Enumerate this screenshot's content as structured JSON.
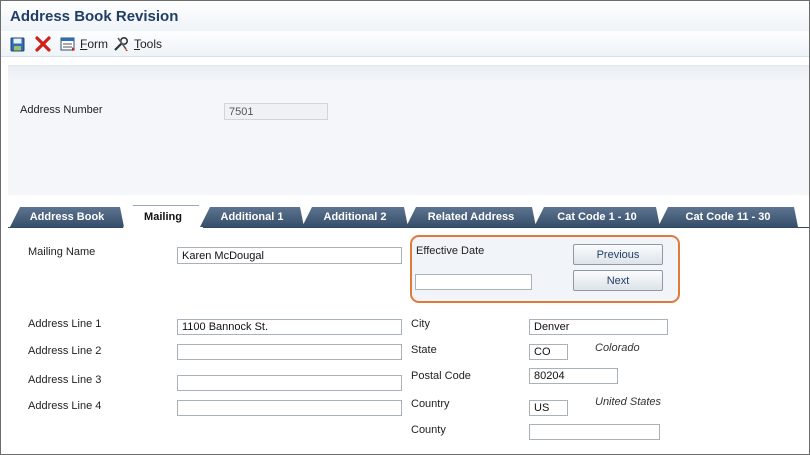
{
  "window": {
    "title": "Address Book Revision"
  },
  "toolbar": {
    "save_icon": "save-icon",
    "cancel_icon": "close-icon",
    "form_label_first": "F",
    "form_label_rest": "orm",
    "tools_label_first": "T",
    "tools_label_rest": "ools"
  },
  "header": {
    "address_number_label": "Address Number",
    "address_number_value": "7501"
  },
  "tabs": [
    {
      "label": "Address Book"
    },
    {
      "label": "Mailing",
      "active": true
    },
    {
      "label": "Additional 1"
    },
    {
      "label": "Additional 2"
    },
    {
      "label": "Related Address"
    },
    {
      "label": "Cat Code 1 - 10"
    },
    {
      "label": "Cat Code 11 - 30"
    }
  ],
  "mailing": {
    "mailing_name_label": "Mailing Name",
    "mailing_name_value": "Karen McDougal",
    "effective_date_label": "Effective Date",
    "effective_date_value": "",
    "previous_label": "Previous",
    "next_label": "Next",
    "address_line_1_label": "Address Line 1",
    "address_line_1_value": "1100 Bannock St.",
    "address_line_2_label": "Address Line 2",
    "address_line_2_value": "",
    "address_line_3_label": "Address Line 3",
    "address_line_3_value": "",
    "address_line_4_label": "Address Line 4",
    "address_line_4_value": "",
    "city_label": "City",
    "city_value": "Denver",
    "state_label": "State",
    "state_value": "CO",
    "state_desc": "Colorado",
    "postal_code_label": "Postal Code",
    "postal_code_value": "80204",
    "country_label": "Country",
    "country_value": "US",
    "country_desc": "United States",
    "county_label": "County",
    "county_value": ""
  },
  "colors": {
    "title": "#1f3f67",
    "tab_bg": "#4a627d",
    "highlight_border": "#e07a3a"
  }
}
